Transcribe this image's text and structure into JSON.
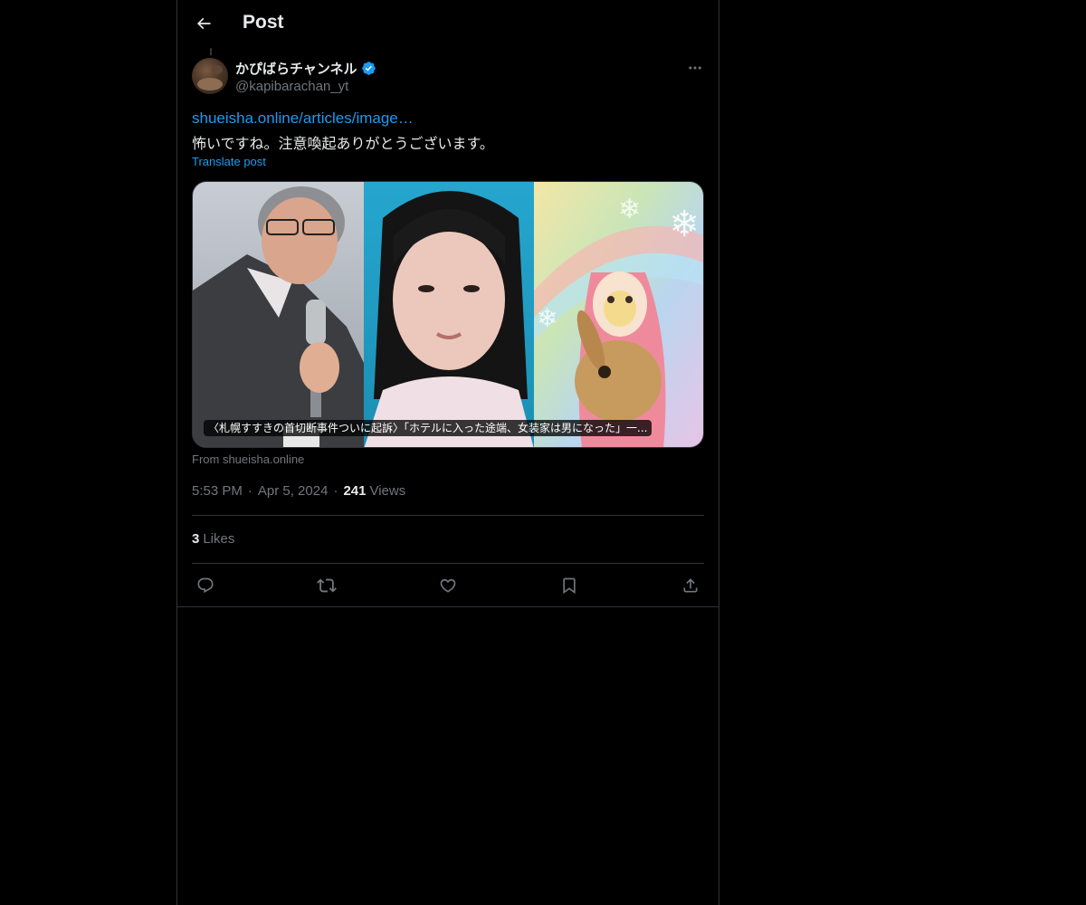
{
  "header": {
    "back_icon": "arrow-left-icon",
    "title": "Post"
  },
  "post": {
    "author": {
      "name": "かぴばらチャンネル",
      "handle": "@kapibarachan_yt",
      "verified": true,
      "verified_color": "#1d9bf0"
    },
    "link_text": "shueisha.online/articles/image…",
    "text": "怖いですね。注意喚起ありがとうございます。",
    "translate_label": "Translate post",
    "card": {
      "caption": "〈札幌すすきの首切断事件ついに起訴〉「ホテルに入った途端、女装家は男になった」一...",
      "source": "From shueisha.online"
    },
    "time": "5:53 PM",
    "date": "Apr 5, 2024",
    "separator": "·",
    "views_count": "241",
    "views_label": "Views",
    "likes_count": "3",
    "likes_label": "Likes"
  },
  "actions": [
    {
      "name": "reply",
      "icon": "reply-icon"
    },
    {
      "name": "repost",
      "icon": "repost-icon"
    },
    {
      "name": "like",
      "icon": "heart-icon"
    },
    {
      "name": "bookmark",
      "icon": "bookmark-icon"
    },
    {
      "name": "share",
      "icon": "share-icon"
    }
  ],
  "colors": {
    "background": "#000000",
    "border": "#2f3336",
    "text_primary": "#e7e9ea",
    "text_secondary": "#71767b",
    "accent": "#1d9bf0"
  }
}
